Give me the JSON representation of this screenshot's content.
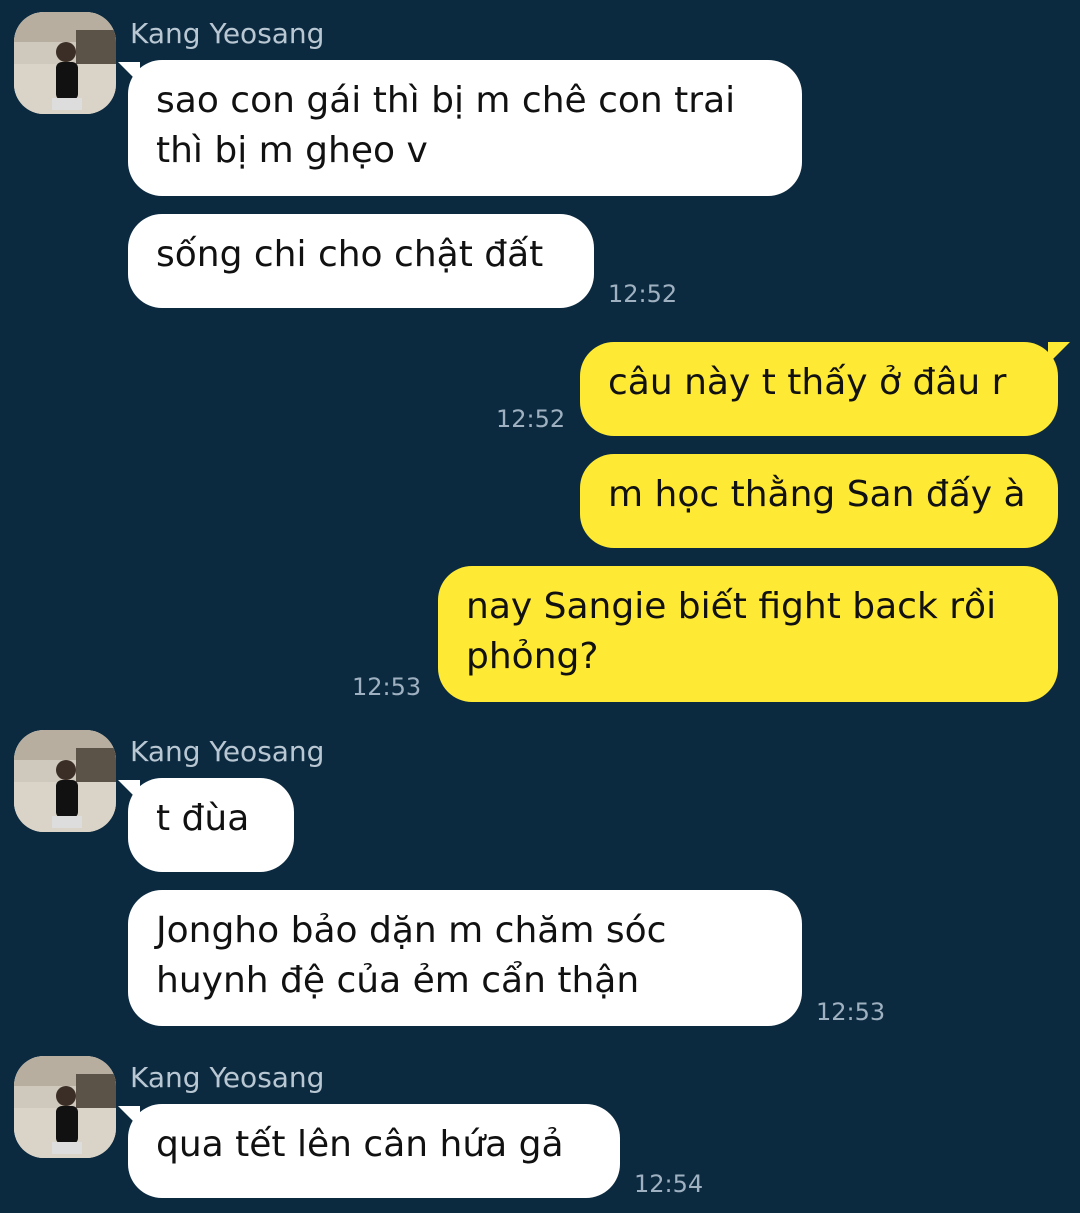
{
  "contact": {
    "name": "Kang Yeosang"
  },
  "messages": [
    {
      "text": "sao con gái thì bị m chê con trai\nthì bị m ghẹo v"
    },
    {
      "text": "sống chi cho chật đất",
      "time": "12:52"
    },
    {
      "text": "câu này t thấy ở đâu r",
      "time": "12:52"
    },
    {
      "text": "m học thằng San đấy à"
    },
    {
      "text": "nay Sangie biết fight back rồi\nphỏng?",
      "time": "12:53"
    },
    {
      "text": "t đùa"
    },
    {
      "text": "Jongho bảo dặn m chăm sóc\nhuynh đệ của ẻm cẩn thận",
      "time": "12:53"
    },
    {
      "text": "qua tết lên cân hứa gả",
      "time": "12:54"
    }
  ],
  "colors": {
    "background": "#0b2a40",
    "incoming_bubble": "#ffffff",
    "outgoing_bubble": "#fee934",
    "sender_name": "#b9c7d3",
    "timestamp": "#9fb1c0"
  }
}
